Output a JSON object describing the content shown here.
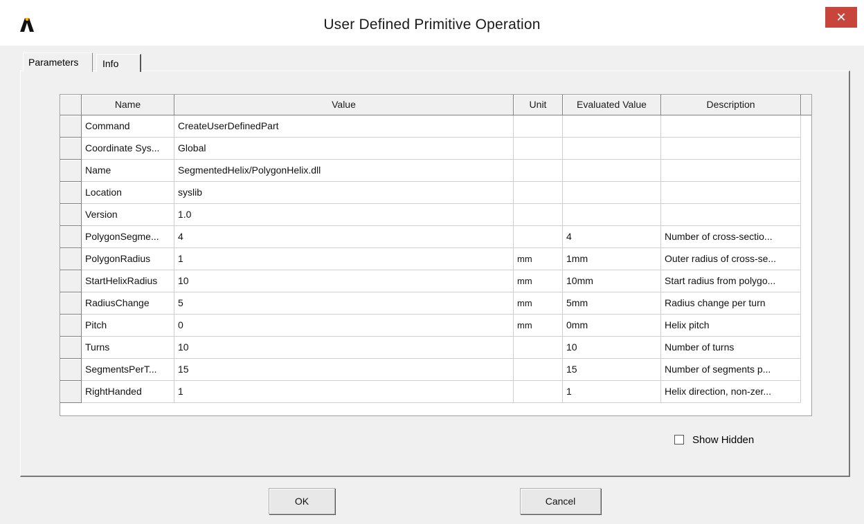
{
  "window": {
    "title": "User Defined Primitive Operation",
    "close_glyph": "✕",
    "accent": "#c7453a"
  },
  "tabs": [
    {
      "label": "Parameters"
    },
    {
      "label": "Info"
    }
  ],
  "table": {
    "columns": [
      "Name",
      "Value",
      "Unit",
      "Evaluated Value",
      "Description"
    ],
    "rows": [
      {
        "name": "Command",
        "value": "CreateUserDefinedPart",
        "unit": "",
        "evaluated": "",
        "description": ""
      },
      {
        "name": "Coordinate Sys...",
        "value": "Global",
        "unit": "",
        "evaluated": "",
        "description": ""
      },
      {
        "name": "Name",
        "value": "SegmentedHelix/PolygonHelix.dll",
        "unit": "",
        "evaluated": "",
        "description": ""
      },
      {
        "name": "Location",
        "value": "syslib",
        "unit": "",
        "evaluated": "",
        "description": ""
      },
      {
        "name": "Version",
        "value": "1.0",
        "unit": "",
        "evaluated": "",
        "description": ""
      },
      {
        "name": "PolygonSegme...",
        "value": "4",
        "unit": "",
        "evaluated": "4",
        "description": "Number of cross-sectio..."
      },
      {
        "name": "PolygonRadius",
        "value": "1",
        "unit": "mm",
        "evaluated": "1mm",
        "description": "Outer radius of cross-se..."
      },
      {
        "name": "StartHelixRadius",
        "value": "10",
        "unit": "mm",
        "evaluated": "10mm",
        "description": "Start radius from polygo..."
      },
      {
        "name": "RadiusChange",
        "value": "5",
        "unit": "mm",
        "evaluated": "5mm",
        "description": "Radius change per turn"
      },
      {
        "name": "Pitch",
        "value": "0",
        "unit": "mm",
        "evaluated": "0mm",
        "description": "Helix pitch"
      },
      {
        "name": "Turns",
        "value": "10",
        "unit": "",
        "evaluated": "10",
        "description": "Number of turns"
      },
      {
        "name": "SegmentsPerT...",
        "value": "15",
        "unit": "",
        "evaluated": "15",
        "description": "Number of segments p..."
      },
      {
        "name": "RightHanded",
        "value": "1",
        "unit": "",
        "evaluated": "1",
        "description": "Helix direction, non-zer..."
      }
    ]
  },
  "show_hidden": {
    "label": "Show Hidden",
    "checked": false
  },
  "buttons": {
    "ok": "OK",
    "cancel": "Cancel"
  }
}
